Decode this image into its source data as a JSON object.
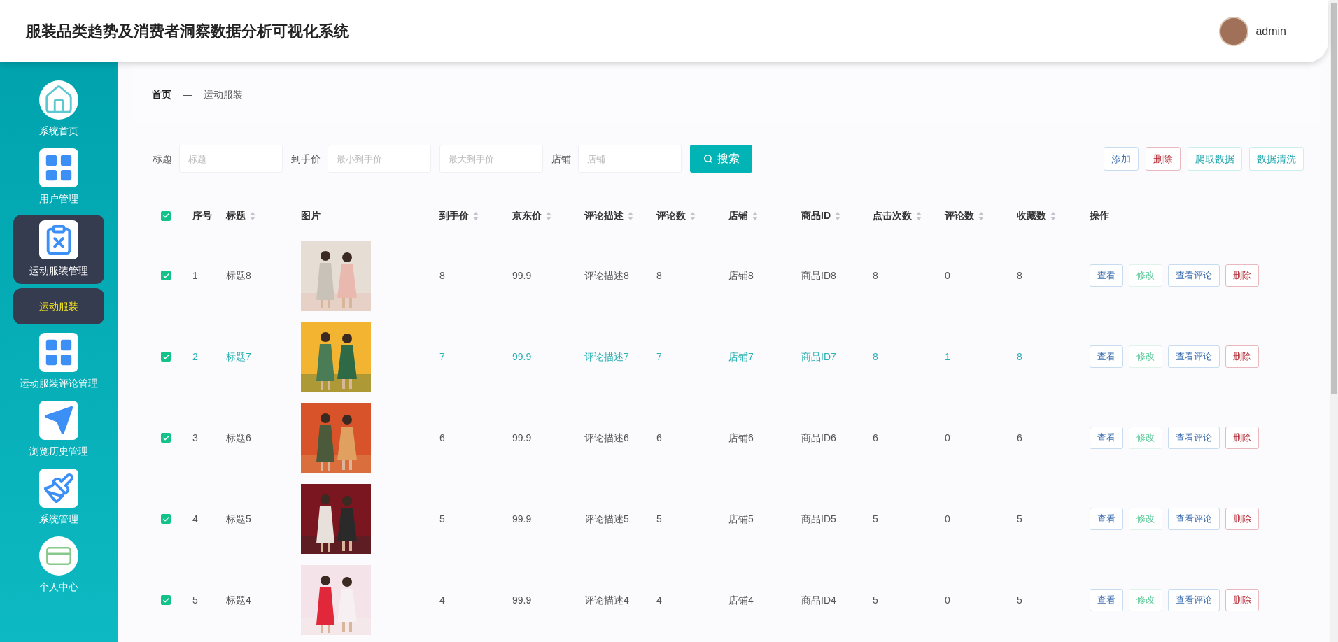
{
  "header": {
    "title": "服装品类趋势及消费者洞察数据分析可视化系统",
    "user": "admin"
  },
  "sidebar": {
    "items": [
      {
        "label": "系统首页",
        "kind": "home",
        "selected": false
      },
      {
        "label": "用户管理",
        "kind": "grid",
        "selected": false
      },
      {
        "label": "运动服装管理",
        "kind": "clipboard",
        "selected": true,
        "children": [
          {
            "label": "运动服装",
            "selected": true
          }
        ]
      },
      {
        "label": "运动服装评论管理",
        "kind": "grid",
        "selected": false
      },
      {
        "label": "浏览历史管理",
        "kind": "plane",
        "selected": false
      },
      {
        "label": "系统管理",
        "kind": "brush",
        "selected": false
      },
      {
        "label": "个人中心",
        "kind": "card",
        "selected": false
      }
    ]
  },
  "breadcrumb": [
    "首页",
    "—",
    "运动服装"
  ],
  "search": {
    "fields": [
      {
        "label": "标题",
        "placeholder": "标题"
      },
      {
        "label": "到手价",
        "placeholder": "最小到手价"
      },
      {
        "placeholder": "最大到手价"
      },
      {
        "label": "店铺",
        "placeholder": "店铺"
      }
    ],
    "button": "搜索"
  },
  "toolbar": [
    {
      "label": "添加",
      "kind": "primary"
    },
    {
      "label": "删除",
      "kind": "danger"
    },
    {
      "label": "爬取数据",
      "kind": "info"
    },
    {
      "label": "数据清洗",
      "kind": "info"
    }
  ],
  "table": {
    "all_checked": true,
    "columns": [
      {
        "label": "序号",
        "sortable": false
      },
      {
        "label": "标题",
        "sortable": true
      },
      {
        "label": "图片",
        "sortable": false
      },
      {
        "label": "到手价",
        "sortable": true
      },
      {
        "label": "京东价",
        "sortable": true
      },
      {
        "label": "评论描述",
        "sortable": true
      },
      {
        "label": "评论数",
        "sortable": true
      },
      {
        "label": "店铺",
        "sortable": true
      },
      {
        "label": "商品ID",
        "sortable": true
      },
      {
        "label": "点击次数",
        "sortable": true
      },
      {
        "label": "评论数",
        "sortable": true
      },
      {
        "label": "收藏数",
        "sortable": true
      },
      {
        "label": "操作",
        "sortable": false
      }
    ],
    "rows": [
      {
        "checked": true,
        "highlighted": false,
        "cells": [
          "1",
          "标题8",
          {
            "kind": "picture"
          },
          "8",
          "99.9",
          "评论描述8",
          "8",
          "店铺8",
          "商品ID8",
          "8",
          "0",
          "8"
        ],
        "actions": [
          {
            "label": "查看",
            "kind": "primary"
          },
          {
            "label": "修改",
            "kind": "success"
          },
          {
            "label": "查看评论",
            "kind": "primary"
          },
          {
            "label": "删除",
            "kind": "danger"
          }
        ]
      },
      {
        "checked": true,
        "highlighted": true,
        "cells": [
          "2",
          "标题7",
          {
            "kind": "picture"
          },
          "7",
          "99.9",
          "评论描述7",
          "7",
          "店铺7",
          "商品ID7",
          "8",
          "1",
          "8"
        ],
        "actions": [
          {
            "label": "查看",
            "kind": "primary"
          },
          {
            "label": "修改",
            "kind": "success"
          },
          {
            "label": "查看评论",
            "kind": "primary"
          },
          {
            "label": "删除",
            "kind": "danger"
          }
        ]
      },
      {
        "checked": true,
        "highlighted": false,
        "cells": [
          "3",
          "标题6",
          {
            "kind": "picture"
          },
          "6",
          "99.9",
          "评论描述6",
          "6",
          "店铺6",
          "商品ID6",
          "6",
          "0",
          "6"
        ],
        "actions": [
          {
            "label": "查看",
            "kind": "primary"
          },
          {
            "label": "修改",
            "kind": "success"
          },
          {
            "label": "查看评论",
            "kind": "primary"
          },
          {
            "label": "删除",
            "kind": "danger"
          }
        ]
      },
      {
        "checked": true,
        "highlighted": false,
        "cells": [
          "4",
          "标题5",
          {
            "kind": "picture"
          },
          "5",
          "99.9",
          "评论描述5",
          "5",
          "店铺5",
          "商品ID5",
          "5",
          "0",
          "5"
        ],
        "actions": [
          {
            "label": "查看",
            "kind": "primary"
          },
          {
            "label": "修改",
            "kind": "success"
          },
          {
            "label": "查看评论",
            "kind": "primary"
          },
          {
            "label": "删除",
            "kind": "danger"
          }
        ]
      },
      {
        "checked": true,
        "highlighted": false,
        "cells": [
          "5",
          "标题4",
          {
            "kind": "picture"
          },
          "4",
          "99.9",
          "评论描述4",
          "4",
          "店铺4",
          "商品ID4",
          "5",
          "0",
          "5"
        ],
        "actions": [
          {
            "label": "查看",
            "kind": "primary"
          },
          {
            "label": "修改",
            "kind": "success"
          },
          {
            "label": "查看评论",
            "kind": "primary"
          },
          {
            "label": "删除",
            "kind": "danger"
          }
        ]
      }
    ]
  }
}
